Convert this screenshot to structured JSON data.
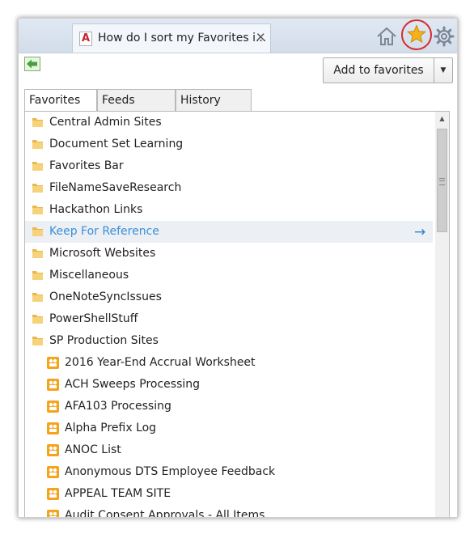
{
  "browser": {
    "tab": {
      "favicon": "pdf-icon",
      "favicon_letter": "A",
      "title": "How do I sort my Favorites i...",
      "close_glyph": "✕"
    },
    "commands": [
      "home-icon",
      "favorites-star-icon",
      "settings-gear-icon"
    ],
    "highlight_color": "#d62c2c"
  },
  "favorites_panel": {
    "back_icon": "dock-arrow-icon",
    "add_button_label": "Add to favorites",
    "add_dropdown_glyph": "▼",
    "tabs": [
      {
        "label": "Favorites",
        "active": true
      },
      {
        "label": "Feeds",
        "active": false
      },
      {
        "label": "History",
        "active": false
      }
    ],
    "items": [
      {
        "label": "Central Admin Sites",
        "type": "folder"
      },
      {
        "label": "Document Set Learning",
        "type": "folder"
      },
      {
        "label": "Favorites Bar",
        "type": "folder"
      },
      {
        "label": "FileNameSaveResearch",
        "type": "folder"
      },
      {
        "label": "Hackathon Links",
        "type": "folder"
      },
      {
        "label": "Keep For Reference",
        "type": "folder",
        "hover": true
      },
      {
        "label": "Microsoft Websites",
        "type": "folder"
      },
      {
        "label": "Miscellaneous",
        "type": "folder"
      },
      {
        "label": "OneNoteSyncIssues",
        "type": "folder"
      },
      {
        "label": "PowerShellStuff",
        "type": "folder"
      },
      {
        "label": "SP Production Sites",
        "type": "folder"
      },
      {
        "label": "2016 Year-End Accrual Worksheet",
        "type": "link"
      },
      {
        "label": "ACH Sweeps Processing",
        "type": "link"
      },
      {
        "label": "AFA103 Processing",
        "type": "link"
      },
      {
        "label": "Alpha Prefix Log",
        "type": "link"
      },
      {
        "label": "ANOC List",
        "type": "link"
      },
      {
        "label": "Anonymous DTS Employee Feedback",
        "type": "link"
      },
      {
        "label": "APPEAL TEAM SITE",
        "type": "link"
      },
      {
        "label": "Audit Consent Approvals - All Items",
        "type": "link"
      }
    ],
    "hover_arrow": "→",
    "scroll_up_glyph": "▲",
    "colors": {
      "folder": "#e8b84a",
      "sharepoint": "#f4a31a",
      "link_hover": "#3a8fd9",
      "accent": "#2b82cc"
    }
  }
}
